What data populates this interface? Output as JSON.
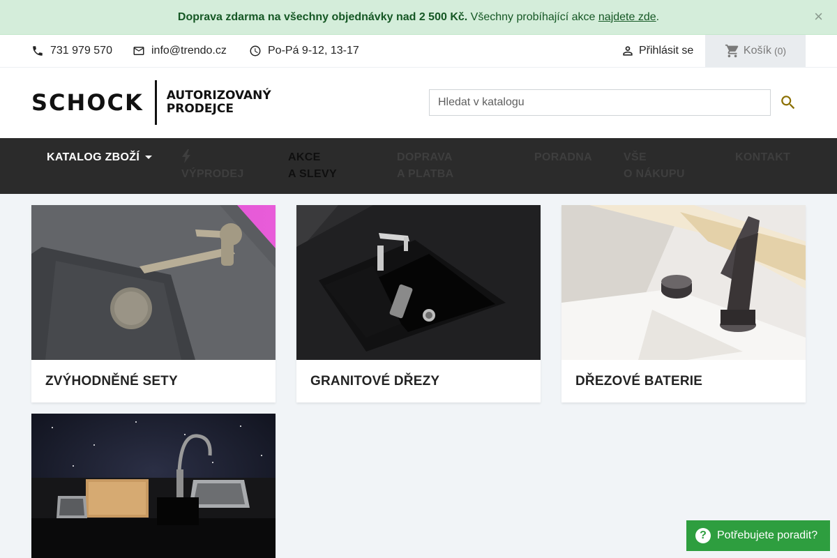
{
  "promo": {
    "bold": "Doprava zdarma na všechny objednávky nad 2 500 Kč.",
    "text": "Všechny probíhající akce",
    "link": "najdete zde",
    "end": ".",
    "close": "×"
  },
  "contact": {
    "phone": "731 979 570",
    "email": "info@trendo.cz",
    "hours": "Po-Pá 9-12, 13-17",
    "login": "Přihlásit se",
    "cart_label": "Košík",
    "cart_count": "(0)"
  },
  "header": {
    "logo_brand": "SCHOCK",
    "logo_line1": "AUTORIZOVANÝ",
    "logo_line2": "PRODEJCE",
    "search_placeholder": "Hledat v katalogu"
  },
  "nav": {
    "catalog": "KATALOG ZBOŽÍ",
    "sale": "VÝPRODEJ",
    "deals_1": "AKCE",
    "deals_2": "A SLEVY",
    "shipping_1": "DOPRAVA",
    "shipping_2": "A PLATBA",
    "advice": "PORADNA",
    "about_1": "VŠE",
    "about_2": "O NÁKUPU",
    "contact": "KONTAKT"
  },
  "categories": [
    {
      "label": "ZVÝHODNĚNÉ SETY"
    },
    {
      "label": "GRANITOVÉ DŘEZY"
    },
    {
      "label": "DŘEZOVÉ BATERIE"
    },
    {
      "label": ""
    }
  ],
  "help": {
    "label": "Potřebujete poradit?",
    "icon_glyph": "?"
  },
  "colors": {
    "promo_bg": "#d4edda",
    "nav_bg": "#2b2b2b",
    "accent": "#8b6f00",
    "help_bg": "#2e9e3f"
  }
}
